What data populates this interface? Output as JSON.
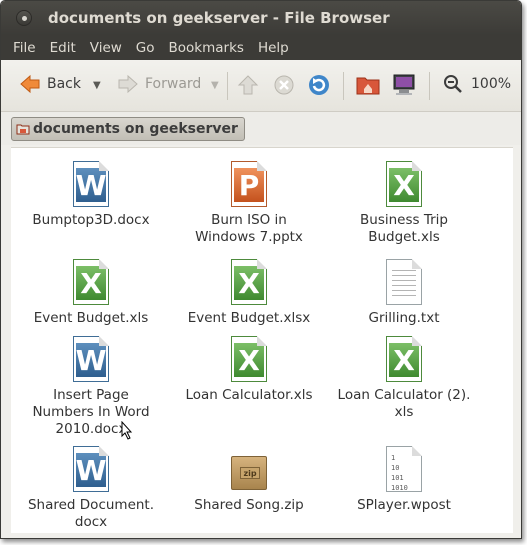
{
  "window": {
    "title": "documents on geekserver - File Browser"
  },
  "menu": [
    "File",
    "Edit",
    "View",
    "Go",
    "Bookmarks",
    "Help"
  ],
  "toolbar": {
    "back_label": "Back",
    "forward_label": "Forward",
    "zoom_value": "100%"
  },
  "location": {
    "crumb": "documents on geekserver"
  },
  "files": [
    {
      "name": "Bumptop3D.docx",
      "type": "word"
    },
    {
      "name": "Burn ISO in\nWindows 7.pptx",
      "type": "ppt"
    },
    {
      "name": "Business Trip\nBudget.xls",
      "type": "excel"
    },
    {
      "name": "Event Budget.xls",
      "type": "excel"
    },
    {
      "name": "Event Budget.xlsx",
      "type": "excel"
    },
    {
      "name": "Grilling.txt",
      "type": "txt"
    },
    {
      "name": "Insert Page\nNumbers In Word\n2010.docx",
      "type": "word"
    },
    {
      "name": "Loan Calculator.xls",
      "type": "excel"
    },
    {
      "name": "Loan Calculator (2).\nxls",
      "type": "excel"
    },
    {
      "name": "Shared Document.\ndocx",
      "type": "word"
    },
    {
      "name": "Shared Song.zip",
      "type": "zip"
    },
    {
      "name": "SPlayer.wpost",
      "type": "bin"
    }
  ],
  "icon_letters": {
    "word": "W",
    "excel": "X",
    "ppt": "P",
    "zip": "zip",
    "bin": "1\n10\n101\n1010"
  },
  "colors": {
    "title_bg": "#3c3b37",
    "title_text": "#dfdbd2",
    "toolbar_bg": "#f0efeb",
    "accent": "#f07746"
  }
}
